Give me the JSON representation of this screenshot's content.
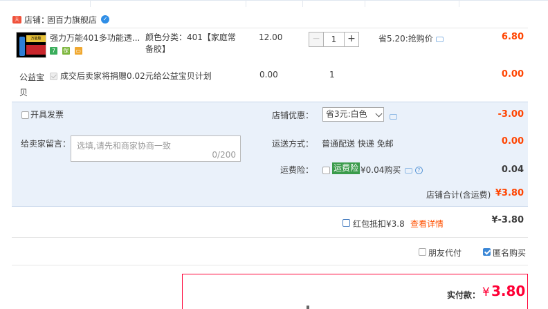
{
  "shop": {
    "badge": "天猫",
    "label": "店铺：",
    "name": "固百力旗舰店"
  },
  "item": {
    "title": "强力万能401多功能透...",
    "sku_label": "颜色分类：401【家庭常备胶】",
    "price": "12.00",
    "quantity": "1",
    "promo": "省5.20:抢购价",
    "subtotal": "6.80",
    "thumb_text": "万能胶"
  },
  "charity": {
    "label": "公益宝贝",
    "text": "成交后卖家将捐赠0.02元给公益宝贝计划",
    "price": "0.00",
    "quantity": "1",
    "subtotal": "0.00"
  },
  "order": {
    "invoice_label": "开具发票",
    "discount_label": "店铺优惠：",
    "discount_selected": "省3元:白色",
    "discount_amount": "-3.00",
    "memo_label": "给卖家留言：",
    "memo_placeholder": "选填,请先和商家协商一致",
    "memo_count": "0/200",
    "shipping_label": "运送方式：",
    "shipping_value": "普通配送 快递 免邮",
    "shipping_amount": "0.00",
    "insurance_label": "运费险：",
    "insurance_tag": "运费险",
    "insurance_text": "¥0.04购买",
    "insurance_amount": "0.04",
    "shop_total_label": "店铺合计(含运费)",
    "shop_total_value": "¥3.80"
  },
  "hongbao": {
    "text": "红包抵扣¥3.8",
    "link": "查看详情",
    "value": "¥-3.80"
  },
  "options": {
    "friend_pay": "朋友代付",
    "anonymous": "匿名购买"
  },
  "payment": {
    "label": "实付款：",
    "currency": "¥",
    "value": "3.80"
  }
}
